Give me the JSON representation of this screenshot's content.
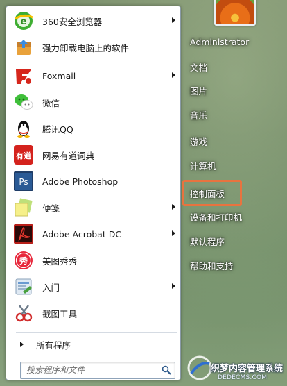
{
  "programs": [
    {
      "label": "360安全浏览器",
      "icon": "360-browser-icon",
      "has_submenu": true
    },
    {
      "label": "强力卸载电脑上的软件",
      "icon": "uninstaller-icon",
      "has_submenu": false
    },
    {
      "label": "Foxmail",
      "icon": "foxmail-icon",
      "has_submenu": true
    },
    {
      "label": "微信",
      "icon": "wechat-icon",
      "has_submenu": false
    },
    {
      "label": "腾讯QQ",
      "icon": "qq-icon",
      "has_submenu": false
    },
    {
      "label": "网易有道词典",
      "icon": "youdao-dict-icon",
      "has_submenu": false
    },
    {
      "label": "Adobe Photoshop",
      "icon": "photoshop-icon",
      "has_submenu": false
    },
    {
      "label": "便笺",
      "icon": "sticky-notes-icon",
      "has_submenu": true
    },
    {
      "label": "Adobe Acrobat DC",
      "icon": "acrobat-icon",
      "has_submenu": true
    },
    {
      "label": "美图秀秀",
      "icon": "meitu-icon",
      "has_submenu": false
    },
    {
      "label": "入门",
      "icon": "getting-started-icon",
      "has_submenu": true
    },
    {
      "label": "截图工具",
      "icon": "snipping-tool-icon",
      "has_submenu": false
    }
  ],
  "all_programs_label": "所有程序",
  "search": {
    "placeholder": "搜索程序和文件"
  },
  "right_items": [
    {
      "label": "Administrator"
    },
    {
      "label": "文档"
    },
    {
      "label": "图片"
    },
    {
      "label": "音乐"
    },
    {
      "label": "游戏"
    },
    {
      "label": "计算机"
    },
    {
      "label": "控制面板"
    },
    {
      "label": "设备和打印机"
    },
    {
      "label": "默认程序"
    },
    {
      "label": "帮助和支持"
    }
  ],
  "highlighted_item": "控制面板",
  "watermark": {
    "line1": "织梦内容管理系统",
    "line2": "DEDECMS.COM"
  },
  "colors": {
    "highlight_border": "#e8733f",
    "left_pane_bg": "#ffffff"
  }
}
